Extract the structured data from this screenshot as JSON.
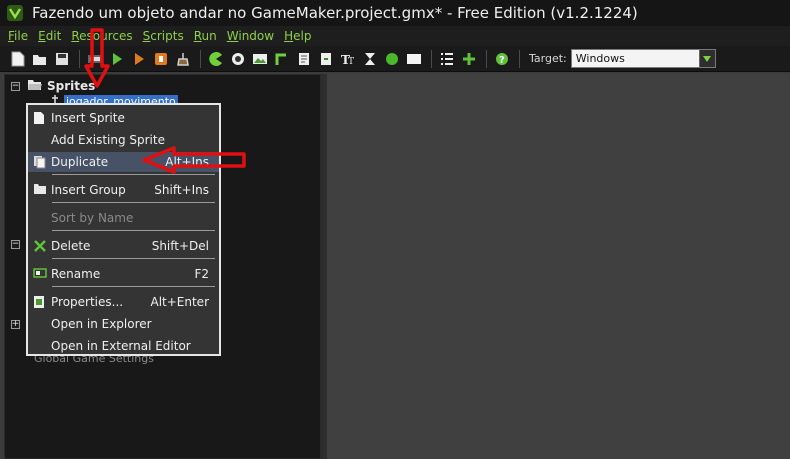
{
  "window": {
    "title": "Fazendo um objeto andar no GameMaker.project.gmx*  -  Free Edition (v1.2.1224)"
  },
  "menubar": {
    "items": [
      {
        "u": "F",
        "rest": "ile"
      },
      {
        "u": "E",
        "rest": "dit"
      },
      {
        "u": "R",
        "rest": "esources"
      },
      {
        "u": "S",
        "rest": "cripts"
      },
      {
        "u": "R",
        "rest": "un"
      },
      {
        "u": "W",
        "rest": "indow"
      },
      {
        "u": "H",
        "rest": "elp"
      }
    ]
  },
  "toolbar": {
    "target_label": "Target:",
    "target_value": "Windows"
  },
  "tree": {
    "sprites_label": "Sprites",
    "selected_item": "jogador_movimento",
    "bottom_item": "Global Game Settings"
  },
  "context_menu": {
    "items": [
      {
        "label": "Insert Sprite",
        "shortcut": "",
        "icon": "insert-sprite-icon"
      },
      {
        "label": "Add Existing Sprite",
        "shortcut": "",
        "icon": ""
      },
      {
        "label": "Duplicate",
        "shortcut": "Alt+Ins",
        "icon": "duplicate-icon"
      },
      {
        "label": "Insert Group",
        "shortcut": "Shift+Ins",
        "icon": "folder-icon"
      },
      {
        "label": "Sort by Name",
        "shortcut": "",
        "icon": ""
      },
      {
        "label": "Delete",
        "shortcut": "Shift+Del",
        "icon": "delete-icon"
      },
      {
        "label": "Rename",
        "shortcut": "F2",
        "icon": "rename-icon"
      },
      {
        "label": "Properties...",
        "shortcut": "Alt+Enter",
        "icon": "properties-icon"
      },
      {
        "label": "Open in Explorer",
        "shortcut": "",
        "icon": ""
      },
      {
        "label": "Open in External Editor",
        "shortcut": "",
        "icon": ""
      }
    ],
    "highlighted_index": 2,
    "disabled_index": 4
  },
  "colors": {
    "menu_text": "#8ed04a",
    "highlight": "#485266",
    "selection": "#3470c8",
    "annotation_arrow": "#e01010"
  }
}
